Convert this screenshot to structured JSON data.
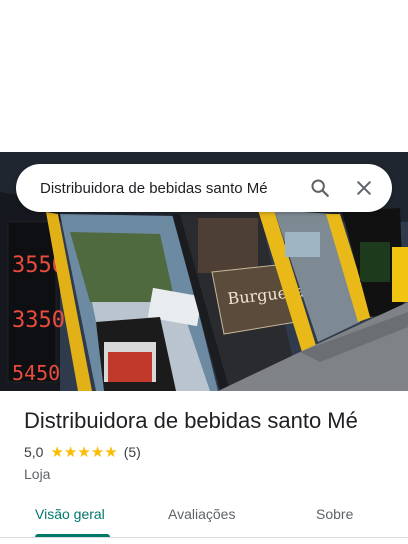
{
  "search": {
    "value": "Distribuidora de bebidas santo Mé",
    "search_icon": "search-icon",
    "close_icon": "close-icon"
  },
  "place": {
    "name": "Distribuidora de bebidas santo Mé",
    "rating": "5,0",
    "review_count": "(5)",
    "stars": 5,
    "category": "Loja"
  },
  "tabs": [
    {
      "label": "Visão geral",
      "active": true
    },
    {
      "label": "Avaliações",
      "active": false
    },
    {
      "label": "Sobre",
      "active": false
    }
  ],
  "colors": {
    "accent": "#00796b",
    "star": "#fbbc04"
  }
}
